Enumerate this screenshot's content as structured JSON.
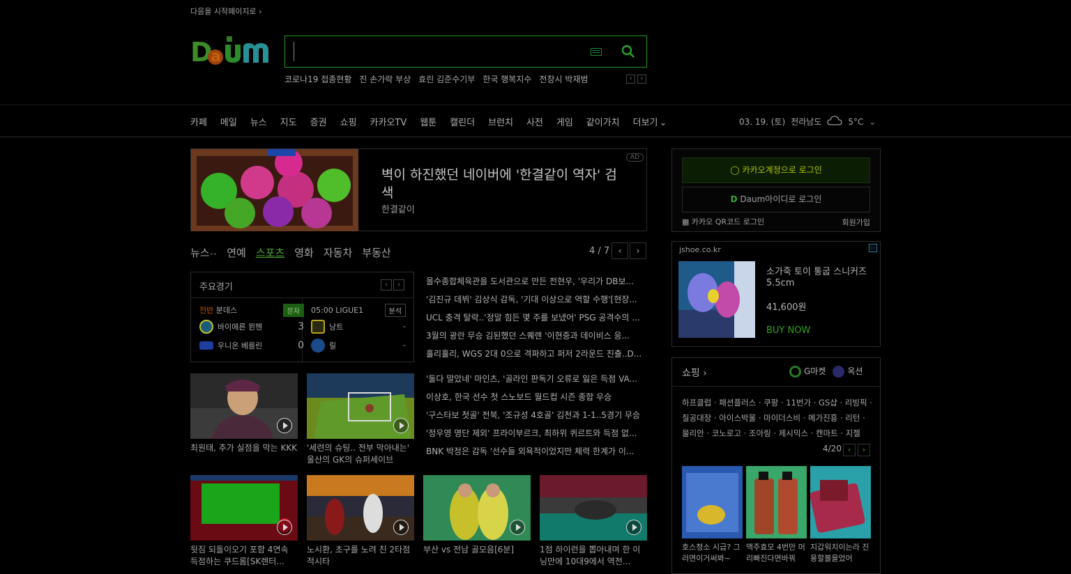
{
  "top": {
    "set_home": "다음을 시작페이지로 ›"
  },
  "logo": {
    "text": "Daum"
  },
  "search": {
    "placeholder": "",
    "value": ""
  },
  "trends": [
    "코로나19 접종현황",
    "진 손가락 부상",
    "효린 김준수기부",
    "한국 행복지수",
    "전창시 박재범"
  ],
  "nav": {
    "items": [
      "카페",
      "메일",
      "뉴스",
      "지도",
      "증권",
      "쇼핑",
      "카카오TV",
      "웹툰",
      "캘린더",
      "브런치",
      "사전",
      "게임",
      "같이가치",
      "더보기"
    ],
    "more_arrow": "⌄",
    "date": "03. 19. (토)",
    "region": "전라남도",
    "temp": "5°C"
  },
  "ad": {
    "title": "벽이 하진했던 네이버에 '한결같이 역자' 검색",
    "subtitle": "한결같이",
    "tag": "AD"
  },
  "news_tabs": {
    "items": [
      "뉴스",
      "연예",
      "스포츠",
      "영화",
      "자동차",
      "부동산"
    ],
    "dots": "••",
    "page": "4 / 7"
  },
  "scores": {
    "title": "주요경기",
    "match1": {
      "status": "전반",
      "league": "분데스",
      "tag": "문자",
      "team1": "바이에른 뮌헨",
      "score1": "3",
      "team2": "우니온 베를린",
      "score2": "0"
    },
    "match2": {
      "status": "05:00",
      "league": "LIGUE1",
      "tag": "분석",
      "team1": "낭트",
      "score1": "-",
      "team2": "릴",
      "score2": "-"
    }
  },
  "headlines": [
    "올수종합체육관을 도서관으로 만든 전현우, '우리가 DB보...",
    "'김진규 데뷔' 김상식 감독, '기대 이상으로 역할 수행'[현장...",
    "UCL 충격 탈락..'정말 힘든 몇 주를 보냈어' PSG 공격수의 ...",
    "3월의 광란 무승 김된했던 스퀘랜 '이현중과 데이비스 응...",
    "훌리훌리, WGS 2대 0으로 격파하고 퍼저 2라운드 진출..D...",
    "'둘다 말았네' 마인츠, '골라인 판독기 오류로 잃은 득점 VA...",
    "이상호, 한국 선수 첫 스노보드 월드컵 시즌 종합 우승",
    "'구스타보 첫골' 전북, '조규성 4호골' 김천과 1-1..5경기 무승",
    "'정우영 명단 제외' 프라이부르크, 최하위 퀴르트와 득점 없...",
    "BNK 박정은 감독 '선수들 외욕적이었지만 체력 한계가 이..."
  ],
  "thumbs_row1": [
    {
      "caption": "최원태, 추가 실점을 막는 KKK"
    },
    {
      "caption": "'세련의 슈팅.. 전부 막아내는' 울산의 GK의 슈퍼세이브"
    }
  ],
  "thumbs_row2": [
    {
      "caption": "뒷짐 되돌이오기 포함 4연속 득점하는 쿠드롬[SK렌터..."
    },
    {
      "caption": "노시환, 초구를 노려 친 2타점 적시타"
    },
    {
      "caption": "부산 vs 전남 골모음[6분]"
    },
    {
      "caption": "1점 하이런을 뽑아내며 한 이닝만에 10대9에서 역전..."
    }
  ],
  "login": {
    "kakao": "카카오계정으로 로그인",
    "daum": "Daum아이디로 로그인",
    "qr": "카카오 QR코드 로그인",
    "join": "회원가입"
  },
  "shop_ad": {
    "domain": "jshoe.co.kr",
    "name": "소가죽 토이 통굽 스니커즈 5.5cm",
    "price": "41,600원",
    "buy": "BUY NOW"
  },
  "shopping": {
    "title": "쇼핑 ›",
    "gmarket": "G마켓",
    "auction": "옥션",
    "categories": "하프클럽 · 패션플러스 · 쿠팡 · 11번가 · GS샵 · 리빙픽 · 질공대장 · 아이스박물 · 마이더스비 · 메가진흥 · 리턴 · 물리안 · 코노로고 · 조아링 · 제시믹스 · 캔마트 · 지젤",
    "page": "4/20",
    "products": [
      {
        "caption": "호스청소 시급? 그러면이거써봐~"
      },
      {
        "caption": "맥주효모 4번만 머리빠진다면바꿔"
      },
      {
        "caption": "지갑워치이는라 진용할볼을었어"
      }
    ]
  },
  "colors": {
    "accent": "#4aa934",
    "search_border": "#1f9a2a",
    "background": "#000000"
  }
}
